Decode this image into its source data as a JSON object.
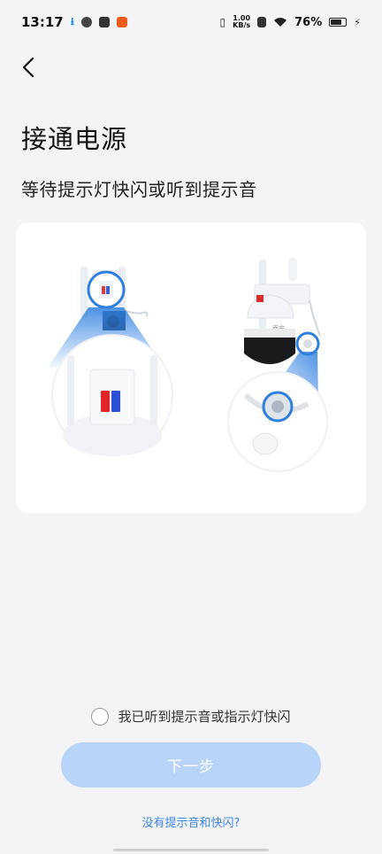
{
  "status_bar": {
    "time": "13:17",
    "net_speed_value": "1.00",
    "net_speed_unit": "KB/s",
    "battery_pct": "76%",
    "battery_level": 0.76
  },
  "header": {
    "back_icon": "chevron-left-icon",
    "title": "接通电源",
    "subtitle": "等待提示灯快闪或听到提示音"
  },
  "illustration": {
    "camera_left": "bullet-camera-indicator-light",
    "camera_right": "dome-camera-indicator-light",
    "camera_right_brand": "乔安",
    "accent_color": "#2f7fe0"
  },
  "confirm": {
    "label": "我已听到提示音或指示灯快闪",
    "checked": false
  },
  "next_button": {
    "label": "下一步"
  },
  "help_link": {
    "label": "没有提示音和快闪?"
  }
}
